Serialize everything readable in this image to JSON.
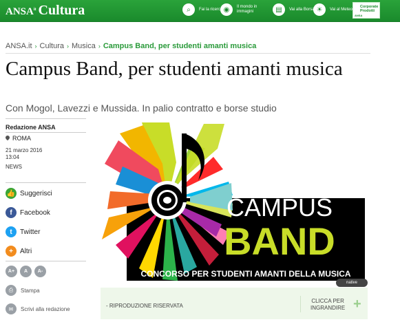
{
  "header": {
    "brand": "ANSA",
    "brand_mark": "it",
    "section": "Cultura",
    "tools": [
      {
        "icon": "binoculars-icon",
        "label": "Fai la ricerca"
      },
      {
        "icon": "globe-icon",
        "label": "Il mondo in immagini"
      },
      {
        "icon": "stock-icon",
        "label": "Vai alla Borsa"
      },
      {
        "icon": "weather-icon",
        "label": "Vai al Meteo"
      }
    ],
    "corporate": {
      "label": "Corporate Prodotti",
      "logo": "ANSA"
    }
  },
  "breadcrumb": {
    "items": [
      "ANSA.it",
      "Cultura",
      "Musica"
    ],
    "current": "Campus Band, per studenti amanti musica",
    "separator": "›"
  },
  "article": {
    "title": "Campus Band, per studenti amanti musica",
    "subtitle": "Con Mogol, Lavezzi e Mussida. In palio contratto e borse studio",
    "author": "Redazione ANSA",
    "place": "ROMA",
    "date": "21 marzo 2016",
    "time": "13:04",
    "type": "NEWS"
  },
  "share": [
    {
      "label": "Suggerisci",
      "icon": "thumbs-up-icon",
      "color": "#3aa635",
      "glyph": "👍"
    },
    {
      "label": "Facebook",
      "icon": "facebook-icon",
      "color": "#3b5998",
      "glyph": "f"
    },
    {
      "label": "Twitter",
      "icon": "twitter-icon",
      "color": "#1da1f2",
      "glyph": "t"
    },
    {
      "label": "Altri",
      "icon": "plus-icon",
      "color": "#f28c1e",
      "glyph": "+"
    }
  ],
  "font_controls": [
    "A+",
    "A",
    "A-"
  ],
  "utilities": [
    {
      "label": "Stampa",
      "icon": "print-icon"
    },
    {
      "label": "Scrivi alla redazione",
      "icon": "mail-icon"
    }
  ],
  "hero": {
    "logo_line1": "CAMPUS",
    "logo_line2": "BAND",
    "tagline": "CONCORSO PER STUDENTI AMANTI DELLA MUSICA"
  },
  "caption": {
    "rights": "- RIPRODUZIONE RISERVATA",
    "enlarge_line1": "CLICCA PER",
    "enlarge_line2": "INGRANDIRE",
    "native": "native"
  },
  "colors": {
    "brand_green": "#1a8a2c",
    "crumb_green": "#2a9a3a",
    "caption_bg": "#eef7ea"
  }
}
